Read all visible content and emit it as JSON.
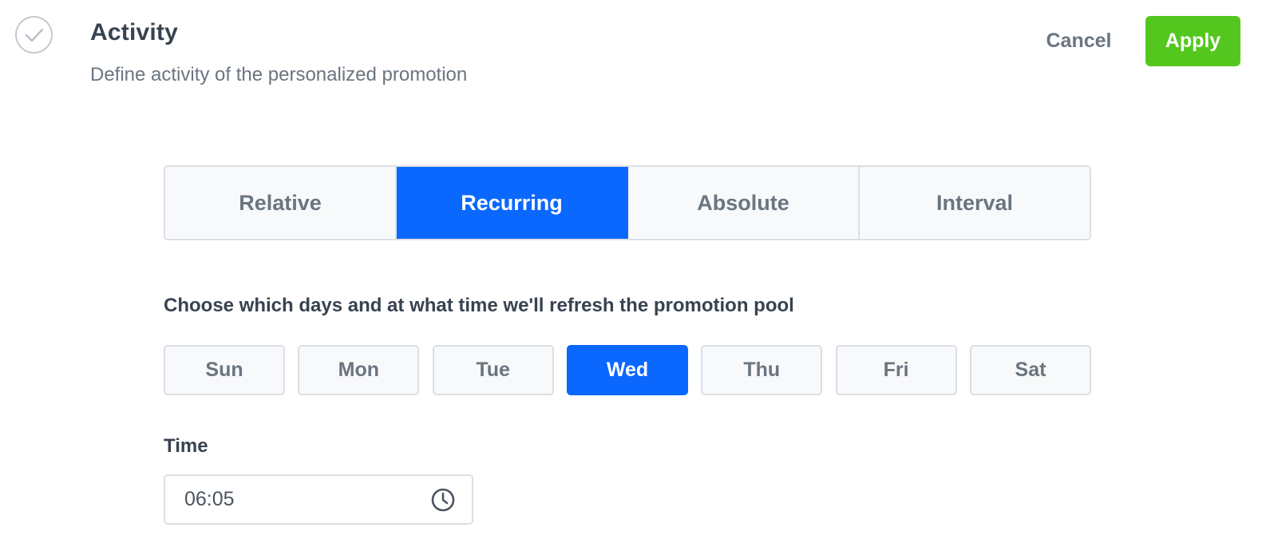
{
  "header": {
    "title": "Activity",
    "subtitle": "Define activity of the personalized promotion",
    "step_icon": "check-circle-icon",
    "cancel_label": "Cancel",
    "apply_label": "Apply"
  },
  "tabs": [
    {
      "label": "Relative",
      "active": false
    },
    {
      "label": "Recurring",
      "active": true
    },
    {
      "label": "Absolute",
      "active": false
    },
    {
      "label": "Interval",
      "active": false
    }
  ],
  "schedule": {
    "instruction": "Choose which days and at what time we'll refresh the promotion pool",
    "days": [
      {
        "label": "Sun",
        "selected": false
      },
      {
        "label": "Mon",
        "selected": false
      },
      {
        "label": "Tue",
        "selected": false
      },
      {
        "label": "Wed",
        "selected": true
      },
      {
        "label": "Thu",
        "selected": false
      },
      {
        "label": "Fri",
        "selected": false
      },
      {
        "label": "Sat",
        "selected": false
      }
    ],
    "time_label": "Time",
    "time_value": "06:05",
    "time_icon": "clock-icon"
  },
  "colors": {
    "accent": "#0b68ff",
    "apply": "#54c71f",
    "text_dark": "#384350",
    "text_muted": "#6a7580",
    "border": "#dbdfe4"
  }
}
